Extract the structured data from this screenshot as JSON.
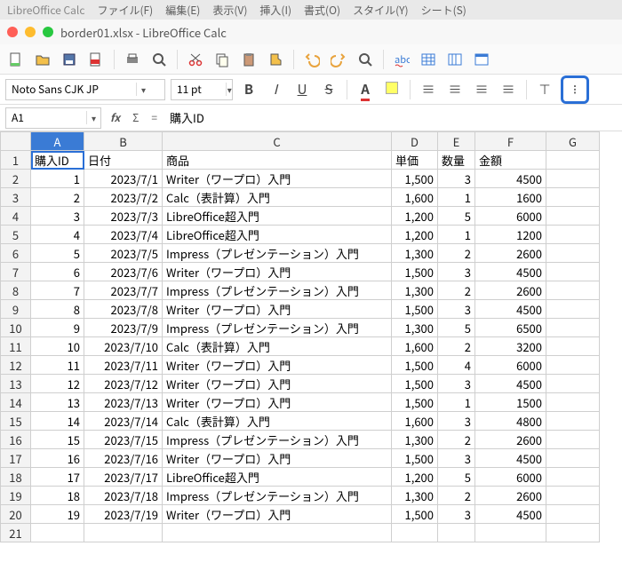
{
  "menubar": {
    "app": "LibreOffice Calc",
    "items": [
      "ファイル(F)",
      "編集(E)",
      "表示(V)",
      "挿入(I)",
      "書式(O)",
      "スタイル(Y)",
      "シート(S)"
    ]
  },
  "window": {
    "title": "border01.xlsx - LibreOffice Calc"
  },
  "format": {
    "font_name": "Noto Sans CJK JP",
    "font_size": "11 pt"
  },
  "refbar": {
    "cell": "A1",
    "fx_label": "fx",
    "sigma": "Σ",
    "eq": "=",
    "formula": "購入ID"
  },
  "columns": [
    "A",
    "B",
    "C",
    "D",
    "E",
    "F",
    "G"
  ],
  "headers": {
    "A": "購入ID",
    "B": "日付",
    "C": "商品",
    "D": "単価",
    "E": "数量",
    "F": "金額"
  },
  "chart_data": {
    "type": "table",
    "columns": [
      "購入ID",
      "日付",
      "商品",
      "単価",
      "数量",
      "金額"
    ],
    "rows": [
      [
        1,
        "2023/7/1",
        "Writer（ワープロ）入門",
        "1,500",
        3,
        4500
      ],
      [
        2,
        "2023/7/2",
        "Calc（表計算）入門",
        "1,600",
        1,
        1600
      ],
      [
        3,
        "2023/7/3",
        "LibreOffice超入門",
        "1,200",
        5,
        6000
      ],
      [
        4,
        "2023/7/4",
        "LibreOffice超入門",
        "1,200",
        1,
        1200
      ],
      [
        5,
        "2023/7/5",
        "Impress（プレゼンテーション）入門",
        "1,300",
        2,
        2600
      ],
      [
        6,
        "2023/7/6",
        "Writer（ワープロ）入門",
        "1,500",
        3,
        4500
      ],
      [
        7,
        "2023/7/7",
        "Impress（プレゼンテーション）入門",
        "1,300",
        2,
        2600
      ],
      [
        8,
        "2023/7/8",
        "Writer（ワープロ）入門",
        "1,500",
        3,
        4500
      ],
      [
        9,
        "2023/7/9",
        "Impress（プレゼンテーション）入門",
        "1,300",
        5,
        6500
      ],
      [
        10,
        "2023/7/10",
        "Calc（表計算）入門",
        "1,600",
        2,
        3200
      ],
      [
        11,
        "2023/7/11",
        "Writer（ワープロ）入門",
        "1,500",
        4,
        6000
      ],
      [
        12,
        "2023/7/12",
        "Writer（ワープロ）入門",
        "1,500",
        3,
        4500
      ],
      [
        13,
        "2023/7/13",
        "Writer（ワープロ）入門",
        "1,500",
        1,
        1500
      ],
      [
        14,
        "2023/7/14",
        "Calc（表計算）入門",
        "1,600",
        3,
        4800
      ],
      [
        15,
        "2023/7/15",
        "Impress（プレゼンテーション）入門",
        "1,300",
        2,
        2600
      ],
      [
        16,
        "2023/7/16",
        "Writer（ワープロ）入門",
        "1,500",
        3,
        4500
      ],
      [
        17,
        "2023/7/17",
        "LibreOffice超入門",
        "1,200",
        5,
        6000
      ],
      [
        18,
        "2023/7/18",
        "Impress（プレゼンテーション）入門",
        "1,300",
        2,
        2600
      ],
      [
        19,
        "2023/7/19",
        "Writer（ワープロ）入門",
        "1,500",
        3,
        4500
      ]
    ]
  },
  "toolbar_icons": [
    "new",
    "open",
    "save",
    "export-pdf",
    "print",
    "print-preview",
    "cut",
    "copy",
    "paste",
    "clone-format",
    "undo",
    "redo",
    "find",
    "spellcheck",
    "table",
    "image",
    "chart"
  ],
  "format_icons": [
    "bold",
    "italic",
    "underline",
    "strikethrough",
    "font-color",
    "highlight-color",
    "align-left",
    "align-center",
    "align-right",
    "align-justify",
    "align-top",
    "align-vcenter"
  ]
}
